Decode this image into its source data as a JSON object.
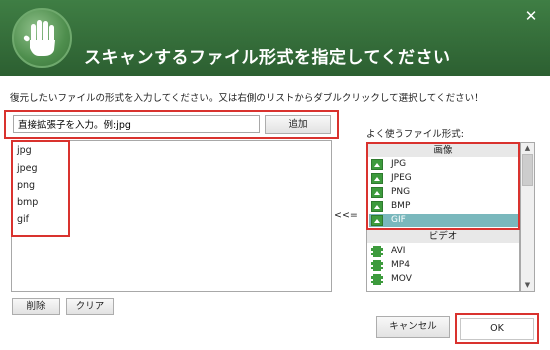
{
  "window": {
    "title": "スキャンするファイル形式を指定してください",
    "close_symbol": "✕",
    "logo_icon": "hand-shield-logo"
  },
  "instruction": "復元したいファイルの形式を入力してください。又は右側のリストからダブルクリックして選択してください！",
  "input": {
    "value": "直接拡張子を入力。例:jpg"
  },
  "add_label": "追加",
  "selected_formats": [
    "jpg",
    "jpeg",
    "png",
    "bmp",
    "gif"
  ],
  "arrow_label": "<<=",
  "frequent_label": "よく使うファイル形式:",
  "categories": {
    "image": {
      "header": "画像",
      "items": [
        "JPG",
        "JPEG",
        "PNG",
        "BMP",
        "GIF"
      ],
      "selected": "GIF"
    },
    "video": {
      "header": "ビデオ",
      "items": [
        "AVI",
        "MP4",
        "MOV"
      ]
    }
  },
  "buttons": {
    "delete": "削除",
    "clear": "クリア",
    "cancel": "キャンセル",
    "ok": "OK"
  },
  "colors": {
    "title_bar": "#2f6634",
    "highlight": "#d9322e",
    "selection": "#7ab8bd",
    "icon_green": "#3d9b3d"
  }
}
